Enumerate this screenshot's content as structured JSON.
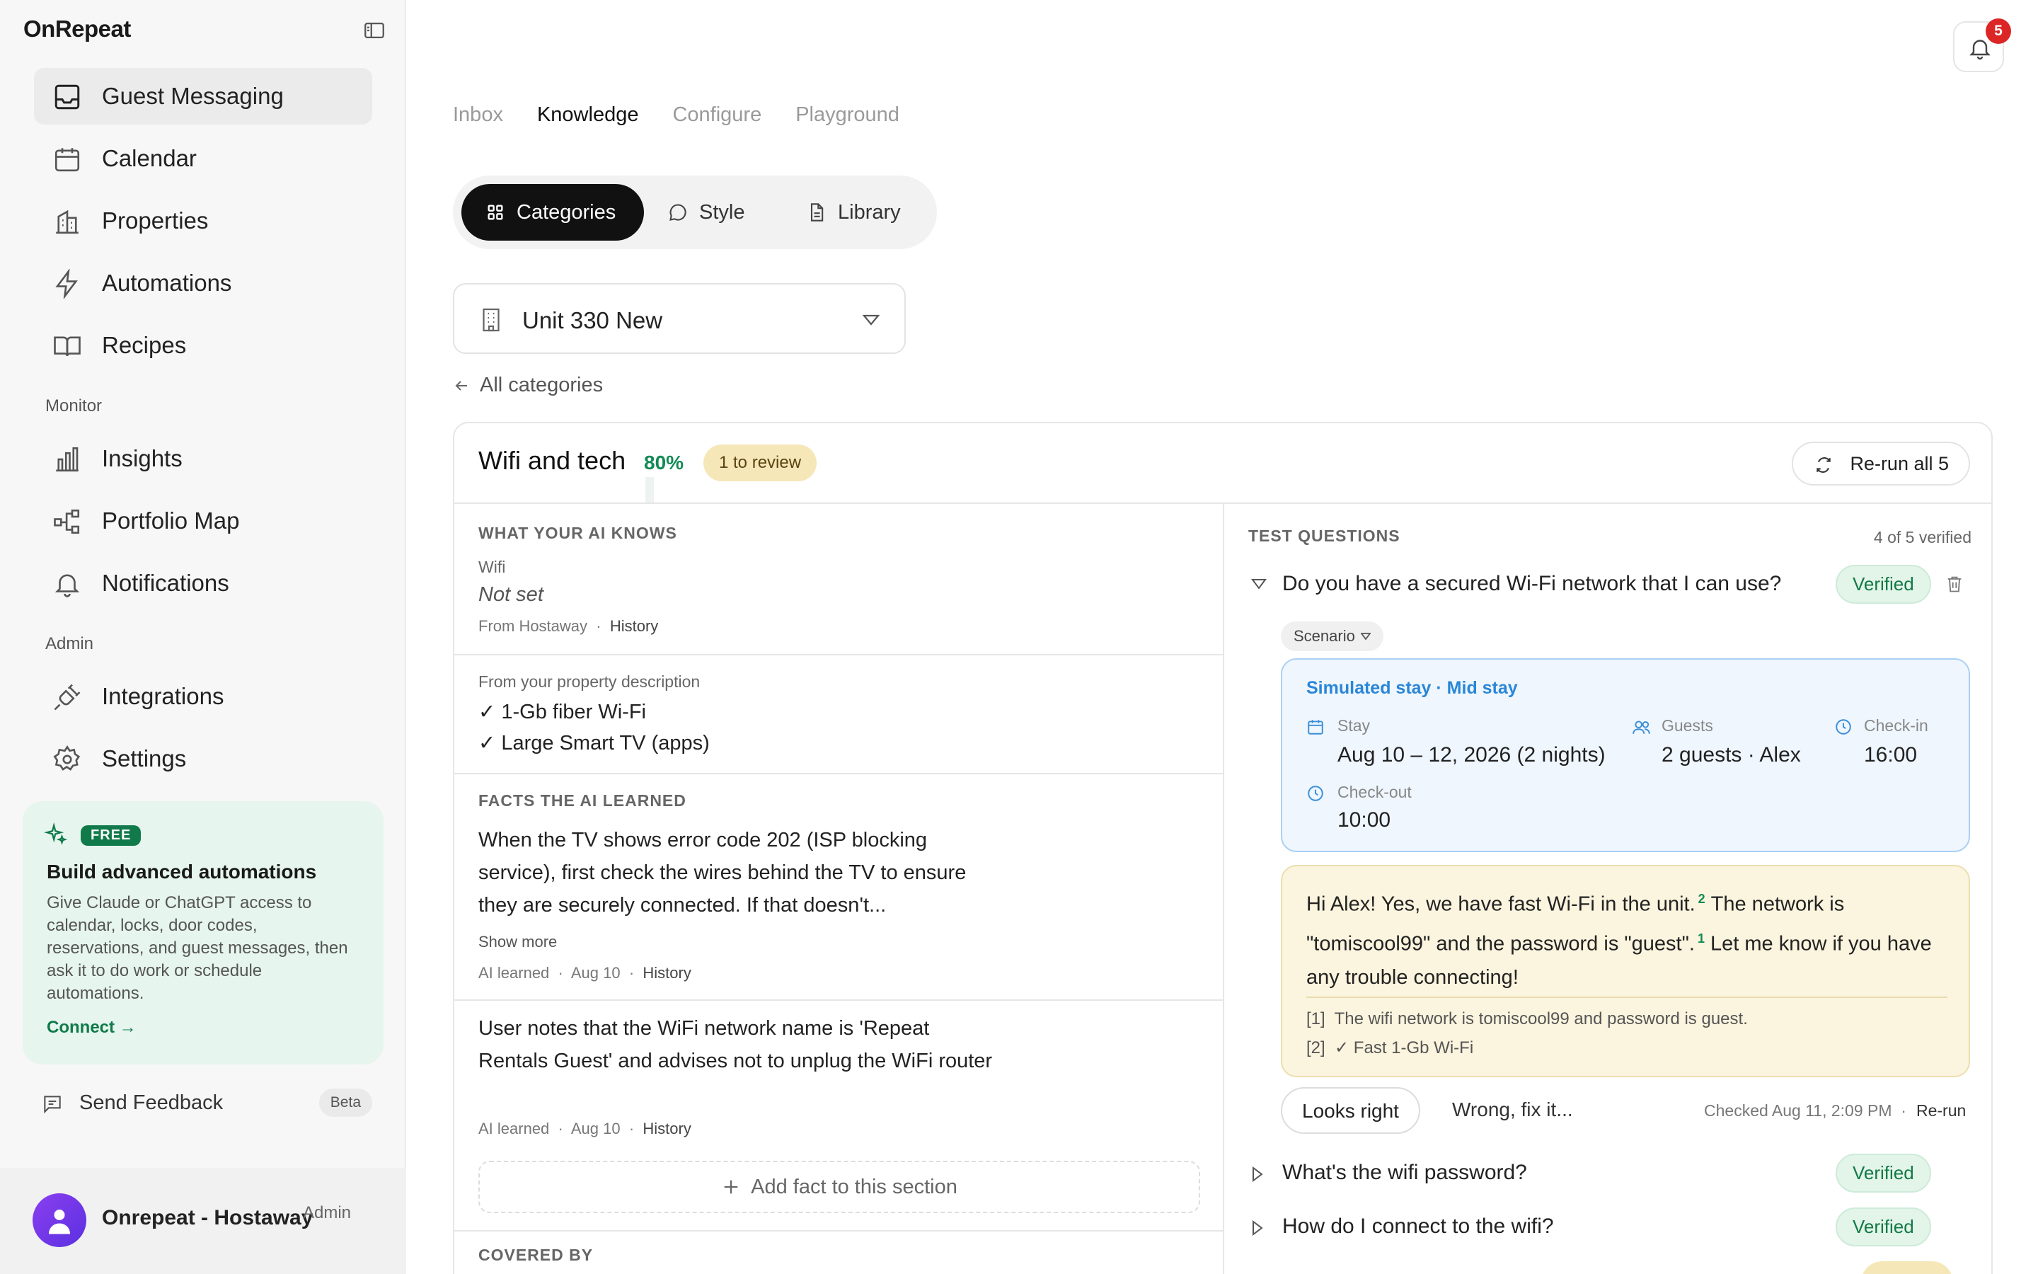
{
  "app": {
    "name": "OnRepeat"
  },
  "sidebar": {
    "items": [
      {
        "label": "Guest Messaging",
        "icon": "inbox-icon",
        "active": true
      },
      {
        "label": "Calendar",
        "icon": "calendar-icon"
      },
      {
        "label": "Properties",
        "icon": "building-icon"
      },
      {
        "label": "Automations",
        "icon": "lightning-icon"
      },
      {
        "label": "Recipes",
        "icon": "book-icon"
      }
    ],
    "monitor_label": "Monitor",
    "monitor_items": [
      {
        "label": "Insights",
        "icon": "bar-chart-icon"
      },
      {
        "label": "Portfolio Map",
        "icon": "map-nodes-icon"
      },
      {
        "label": "Notifications",
        "icon": "bell-icon"
      }
    ],
    "admin_label": "Admin",
    "admin_items": [
      {
        "label": "Integrations",
        "icon": "plug-icon"
      },
      {
        "label": "Settings",
        "icon": "gear-icon"
      }
    ],
    "promo": {
      "badge": "FREE",
      "title": "Build advanced automations",
      "description": "Give Claude or ChatGPT access to calendar, locks, door codes, reservations, and guest messages, then ask it to do work or schedule automations.",
      "link": "Connect →"
    },
    "feedback": {
      "label": "Send Feedback",
      "badge": "Beta"
    },
    "user": {
      "name": "Onrepeat - Hostaway",
      "role": "Admin"
    }
  },
  "header": {
    "notification_count": "5"
  },
  "tabs": [
    "Inbox",
    "Knowledge",
    "Configure",
    "Playground"
  ],
  "active_tab": "Knowledge",
  "segments": [
    {
      "label": "Categories",
      "icon": "grid-icon",
      "active": true
    },
    {
      "label": "Style",
      "icon": "chat-bubble-icon"
    },
    {
      "label": "Library",
      "icon": "document-icon"
    }
  ],
  "unit_select": {
    "value": "Unit 330 New"
  },
  "back_link": "All categories",
  "category": {
    "title": "Wifi and tech",
    "percent": "80%",
    "review_badge": "1 to review",
    "rerun_label": "Re-run all 5"
  },
  "knows": {
    "caption": "WHAT YOUR AI KNOWS",
    "field_label": "Wifi",
    "field_value": "Not set",
    "field_source": "From Hostaway",
    "field_history": "History",
    "desc_label": "From your property description",
    "desc_items": [
      "✓ 1-Gb fiber Wi-Fi",
      "✓ Large Smart TV (apps)"
    ]
  },
  "facts": {
    "caption": "FACTS THE AI LEARNED",
    "items": [
      {
        "text": "When the TV shows error code 202 (ISP blocking service), first check the wires behind the TV to ensure they are securely connected. If that doesn't...",
        "show_more": "Show more",
        "source": "AI learned",
        "date": "Aug 10",
        "history": "History"
      },
      {
        "text": "User notes that the WiFi network name is 'Repeat Rentals Guest' and advises not to unplug the WiFi router",
        "source": "AI learned",
        "date": "Aug 10",
        "history": "History"
      }
    ],
    "add_label": "Add fact to this section"
  },
  "covered_by": {
    "caption": "COVERED BY"
  },
  "tests": {
    "caption": "TEST QUESTIONS",
    "count": "4 of 5 verified",
    "questions": [
      {
        "text": "Do you have a secured Wi-Fi network that I can use?",
        "status": "Verified",
        "expanded": true
      },
      {
        "text": "What's the wifi password?",
        "status": "Verified"
      },
      {
        "text": "How do I connect to the wifi?",
        "status": "Verified"
      }
    ],
    "scenario_label": "Scenario",
    "simulated": {
      "title": "Simulated stay · Mid stay",
      "stay_label": "Stay",
      "stay_value": "Aug 10 – 12, 2026 (2 nights)",
      "guests_label": "Guests",
      "guests_value": "2 guests · Alex",
      "checkin_label": "Check-in",
      "checkin_value": "16:00",
      "checkout_label": "Check-out",
      "checkout_value": "10:00"
    },
    "answer": {
      "part1": "Hi Alex! Yes, we have fast Wi-Fi in the unit.",
      "ref1": "2",
      "part2": "The network is \"tomiscool99\" and the password is \"guest\".",
      "ref2": "1",
      "part3": "Let me know if you have any trouble connecting!",
      "sources": [
        {
          "ref": "[1]",
          "text": "The wifi network is tomiscool99 and password is guest."
        },
        {
          "ref": "[2]",
          "text": "✓ Fast 1-Gb Wi-Fi"
        }
      ]
    },
    "looks_right": "Looks right",
    "wrong": "Wrong, fix it...",
    "checked": "Checked Aug 11, 2:09 PM",
    "rerun": "Re-run"
  }
}
